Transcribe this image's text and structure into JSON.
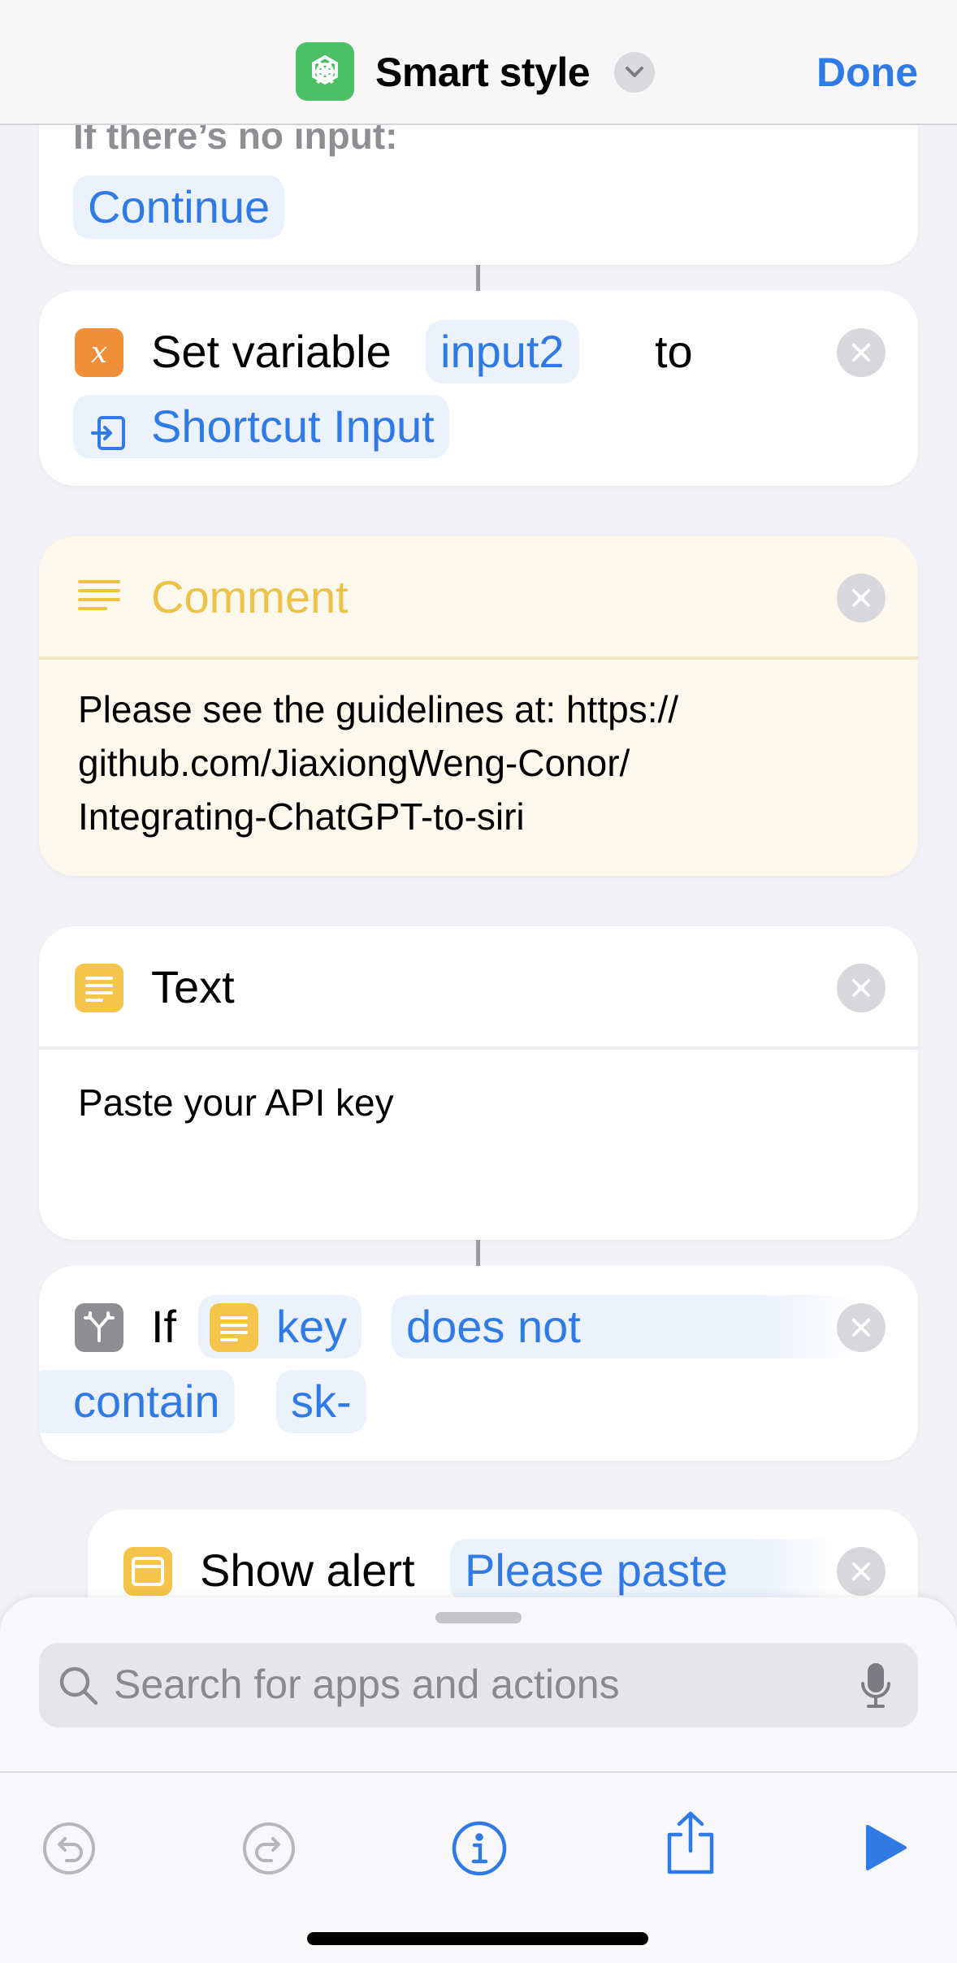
{
  "header": {
    "title": "Smart style",
    "done_label": "Done"
  },
  "top_card": {
    "label": "If there’s no input:",
    "value": "Continue"
  },
  "set_variable": {
    "action": "Set variable",
    "variable": "input2",
    "to": "to",
    "value": "Shortcut Input"
  },
  "comment": {
    "title": "Comment",
    "lines": [
      "Please see the guidelines at: https://",
      "github.com/JiaxiongWeng-Conor/",
      "Integrating-ChatGPT-to-siri"
    ]
  },
  "text_action": {
    "title": "Text",
    "body": "Paste your API key"
  },
  "if_action": {
    "keyword": "If",
    "variable": "key",
    "condition_part1": "does not",
    "condition_part2": "contain",
    "value": "sk-"
  },
  "show_alert": {
    "action": "Show alert",
    "value": "Please paste"
  },
  "search": {
    "placeholder": "Search for apps and actions"
  },
  "icons": {
    "app": "chatgpt-app-icon",
    "variable": "variable-x-icon",
    "shortcut_input": "shortcut-input-icon",
    "comment": "comment-lines-icon",
    "text": "text-icon",
    "if": "if-branch-icon",
    "alert": "alert-window-icon",
    "search": "search-icon",
    "mic": "microphone-icon",
    "undo": "undo-icon",
    "redo": "redo-icon",
    "info": "info-icon",
    "share": "share-icon",
    "play": "play-icon"
  },
  "colors": {
    "accent": "#2f7ae5",
    "comment_title": "#eec24a",
    "comment_bg": "#fcf8ec",
    "variable_orange": "#ef8f3a",
    "text_yellow": "#f5c44a",
    "app_green": "#4cc067"
  }
}
